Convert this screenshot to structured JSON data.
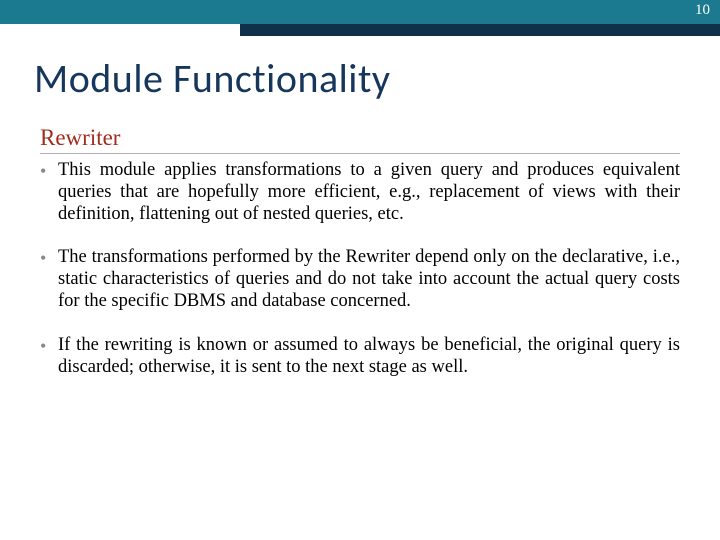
{
  "page_number": "10",
  "title": "Module Functionality",
  "section_heading": "Rewriter",
  "bullets": [
    "This module applies transformations to a given query and produces equivalent queries that are hopefully more efficient, e.g., replacement of views with their definition, flattening out of nested queries, etc.",
    "The transformations performed by the Rewriter depend only on the declarative, i.e., static characteristics of queries and do not take into account the actual query costs for the specific DBMS and database concerned.",
    "If the rewriting is known or assumed to always be beneficial, the original query is discarded; otherwise, it is sent to the next stage as well."
  ]
}
